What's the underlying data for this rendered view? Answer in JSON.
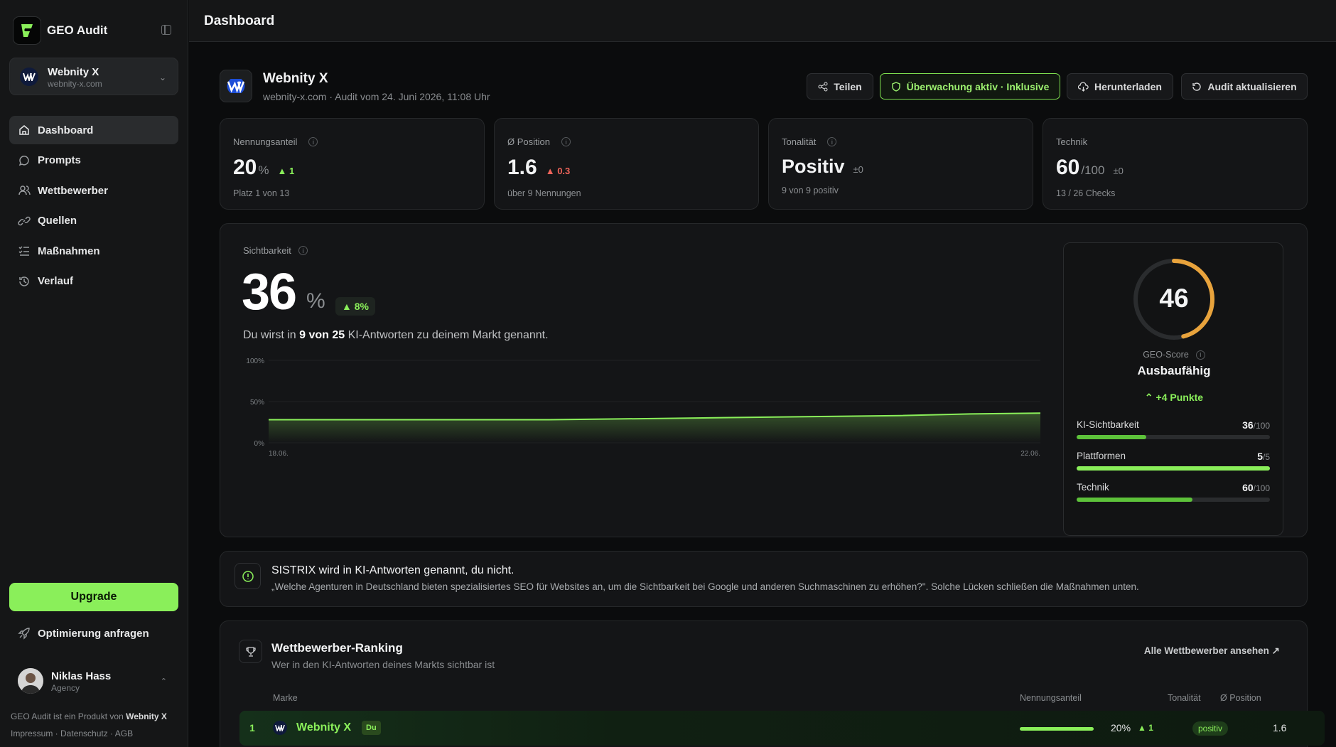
{
  "app": {
    "name": "GEO Audit"
  },
  "project": {
    "name": "Webnity X",
    "domain": "webnity-x.com"
  },
  "nav": {
    "items": [
      {
        "label": "Dashboard",
        "icon": "home-icon",
        "active": true
      },
      {
        "label": "Prompts",
        "icon": "chat-icon"
      },
      {
        "label": "Wettbewerber",
        "icon": "users-icon"
      },
      {
        "label": "Quellen",
        "icon": "link-icon"
      },
      {
        "label": "Maßnahmen",
        "icon": "checklist-icon"
      },
      {
        "label": "Verlauf",
        "icon": "history-icon"
      }
    ]
  },
  "sidebar": {
    "upgrade_label": "Upgrade",
    "optimize_label": "Optimierung anfragen",
    "user": {
      "name": "Niklas Hass",
      "role": "Agency"
    },
    "footer_product": "GEO Audit ist ein Produkt von",
    "footer_brand": "Webnity X",
    "footer_links": [
      "Impressum",
      "Datenschutz",
      "AGB"
    ]
  },
  "page": {
    "title": "Dashboard"
  },
  "header": {
    "project_name": "Webnity X",
    "subtitle": "webnity-x.com · Audit vom 24. Juni 2026, 11:08 Uhr",
    "buttons": {
      "share": "Teilen",
      "monitoring": "Überwachung aktiv · Inklusive",
      "download": "Herunterladen",
      "refresh": "Audit aktualisieren"
    }
  },
  "kpis": [
    {
      "label": "Nennungsanteil",
      "value": "20",
      "unit": "%",
      "delta": "▲ 1",
      "delta_type": "up",
      "note": "Platz 1 von 13"
    },
    {
      "label": "Ø Position",
      "value": "1.6",
      "unit": "",
      "delta": "▲ 0.3",
      "delta_type": "down",
      "note": "über 9 Nennungen"
    },
    {
      "label": "Tonalität",
      "value": "Positiv",
      "unit": "",
      "delta": "±0",
      "delta_type": "neutral",
      "note": "9 von 9 positiv"
    },
    {
      "label": "Technik",
      "value": "60",
      "unit": "/100",
      "delta": "±0",
      "delta_type": "neutral",
      "note": "13 / 26 Checks"
    }
  ],
  "visibility": {
    "label": "Sichtbarkeit",
    "value": "36",
    "unit": "%",
    "delta": "▲ 8%",
    "text_before": "Du wirst in ",
    "text_bold": "9 von 25",
    "text_after": " KI-Antworten zu deinem Markt genannt."
  },
  "chart_data": {
    "type": "area",
    "x": [
      "18.06.",
      "22.06."
    ],
    "y_ticks": [
      "100%",
      "50%",
      "0%"
    ],
    "ylim": [
      0,
      100
    ],
    "series": [
      {
        "values": [
          28,
          28,
          28,
          28,
          28,
          29,
          30,
          31,
          32,
          33,
          35,
          36
        ]
      }
    ],
    "color": "#8aef5a"
  },
  "score": {
    "value": "46",
    "value_num": 46,
    "label": "GEO-Score",
    "status": "Ausbaufähig",
    "change": "+4 Punkte",
    "color": "#e8a33c",
    "metrics": [
      {
        "name": "KI-Sichtbarkeit",
        "value": "36",
        "max": "/100",
        "fraction": 0.36
      },
      {
        "name": "Plattformen",
        "value": "5",
        "max": "/5",
        "fraction": 1.0
      },
      {
        "name": "Technik",
        "value": "60",
        "max": "/100",
        "fraction": 0.6
      }
    ]
  },
  "alert": {
    "title": "SISTRIX wird in KI-Antworten genannt, du nicht.",
    "text": "„Welche Agenturen in Deutschland bieten spezialisiertes SEO für Websites an, um die Sichtbarkeit bei Google und anderen Suchmaschinen zu erhöhen?\". Solche Lücken schließen die Maßnahmen unten."
  },
  "ranking": {
    "title": "Wettbewerber-Ranking",
    "subtitle": "Wer in den KI-Antworten deines Markts sichtbar ist",
    "link": "Alle Wettbewerber ansehen ↗",
    "columns": {
      "brand": "Marke",
      "share": "Nennungsanteil",
      "tone": "Tonalität",
      "position": "Ø Position"
    },
    "rows": [
      {
        "rank": "1",
        "name": "Webnity X",
        "badge": "Du",
        "share": "20%",
        "share_fraction": 0.2,
        "delta": "▲ 1",
        "tone": "positiv",
        "position": "1.6"
      }
    ]
  }
}
